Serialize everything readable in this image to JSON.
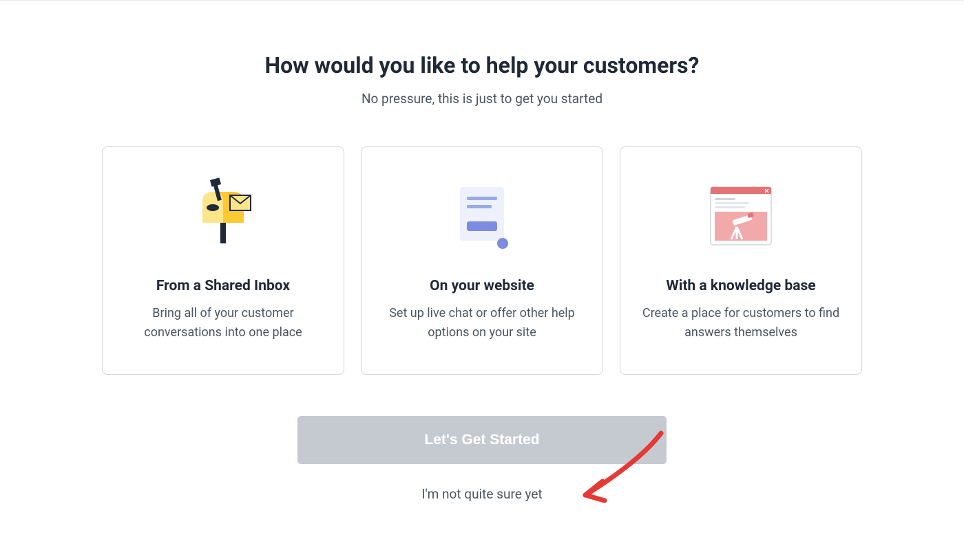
{
  "heading": "How would you like to help your customers?",
  "subheading": "No pressure, this is just to get you started",
  "cards": [
    {
      "title": "From a Shared Inbox",
      "description": "Bring all of your customer conversations into one place",
      "icon": "mailbox-icon"
    },
    {
      "title": "On your website",
      "description": "Set up live chat or offer other help options on your site",
      "icon": "chat-widget-icon"
    },
    {
      "title": "With a knowledge base",
      "description": "Create a place for customers to find answers themselves",
      "icon": "knowledge-base-icon"
    }
  ],
  "primaryButton": "Let's Get Started",
  "secondaryLink": "I'm not quite sure yet",
  "colors": {
    "textDark": "#1f2937",
    "textMuted": "#4b5563",
    "border": "#d1d5db",
    "buttonDisabled": "#c5cad0",
    "accentYellow": "#ffc933",
    "accentBlue": "#7c8ce0",
    "accentSalmon": "#e57373",
    "annotationRed": "#e53935"
  }
}
